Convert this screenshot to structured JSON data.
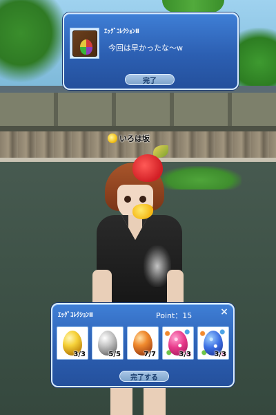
{
  "scene": {
    "player_name": "いろは坂"
  },
  "completion_dialog": {
    "title": "ｴｯｸﾞｺﾚｸｼｮﾝⅡ",
    "message": "今回は早かったな～w",
    "button_label": "完了"
  },
  "collection_panel": {
    "title": "ｴｯｸﾞｺﾚｸｼｮﾝⅡ",
    "points_text": "Point：15",
    "close_icon": "×",
    "eggs": [
      {
        "name": "gold-egg",
        "count": "3/3",
        "color": "#f6d23a"
      },
      {
        "name": "silver-egg",
        "count": "5/5",
        "color": "#c8c8c8"
      },
      {
        "name": "bronze-egg",
        "count": "7/7",
        "color": "#f08a2e"
      },
      {
        "name": "pink-egg",
        "count": "3/3",
        "color": "#e8398a"
      },
      {
        "name": "blue-egg",
        "count": "3/3",
        "color": "#3c6fe3"
      }
    ],
    "button_label": "完了する"
  },
  "theme": {
    "panel_blue": "#2c5fb2",
    "panel_border": "#d9ecff",
    "button_fill": "#a8c6e6"
  }
}
